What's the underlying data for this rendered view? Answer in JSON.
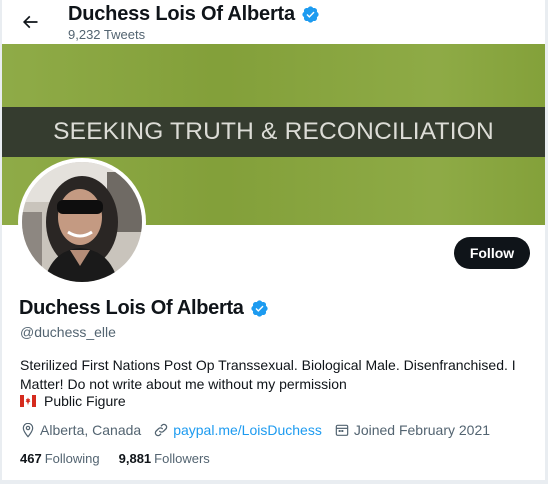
{
  "header": {
    "title": "Duchess Lois Of Alberta",
    "tweet_count": "9,232 Tweets"
  },
  "banner": {
    "text": "SEEKING TRUTH & RECONCILIATION"
  },
  "profile": {
    "display_name": "Duchess Lois Of Alberta",
    "handle": "@duchess_elle",
    "verified": true,
    "follow_label": "Follow",
    "bio_lines": [
      "Sterilized First Nations Post Op Transsexual. Biological Male. Disenfranchised. I",
      "Matter! Do not write about me without my permission"
    ],
    "bio_figure": "Public Figure",
    "location": "Alberta, Canada",
    "website": "paypal.me/LoisDuchess",
    "joined": "Joined February 2021",
    "following_count": "467",
    "following_label": "Following",
    "followers_count": "9,881",
    "followers_label": "Followers"
  },
  "colors": {
    "accent": "#1d9bf0",
    "banner_green": "#88a63c",
    "banner_strip": "#353c2f",
    "follow_button": "#0f1419"
  },
  "icons": {
    "back": "arrow-left-icon",
    "verified": "verified-badge-icon",
    "location": "location-pin-icon",
    "link": "link-icon",
    "calendar": "calendar-icon",
    "flag": "canada-flag-icon"
  }
}
